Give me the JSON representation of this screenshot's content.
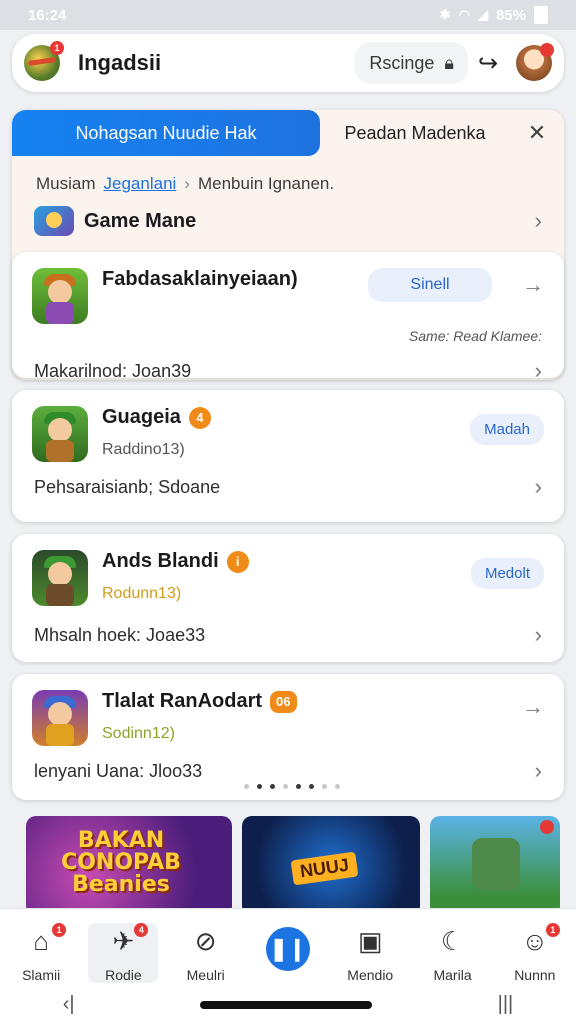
{
  "status": {
    "time": "16:24",
    "battery": "85%"
  },
  "appbar": {
    "title": "Ingadsii",
    "search_label": "Rscinge",
    "notif_count": "1"
  },
  "banner": {
    "tab_label": "Nohagsan Nuudie Hak",
    "tab2_label": "Peadan Madenka",
    "breadcrumb": [
      "Musiam",
      "Jeganlani",
      "Menbuin Ignanen."
    ],
    "game_row_label": "Game Mane"
  },
  "cards": [
    {
      "name": "Fabdasaklainyeiaan)",
      "pill": "Sinell",
      "note": "Same: Read Klamee:",
      "foot": "Makarilnod: Joan39"
    },
    {
      "name": "Guageia",
      "badge": "4",
      "sub": "Raddino13)",
      "pill": "Madah",
      "foot": "Pehsaraisianb; Sdoane"
    },
    {
      "name": "Ands Blandi",
      "badge": "i",
      "sub": "Rodunn13)",
      "pill": "Medolt",
      "foot": "Mhsaln hoek: Joae33"
    },
    {
      "name": "Tlalat RanAodart",
      "badge": "06",
      "sub": "Sodinn12)",
      "foot": "lenyani Uana: Jloo33"
    }
  ],
  "thumbs": {
    "t1": "BAKAN CONOPAB Beanies",
    "t2": "NUUJ"
  },
  "nav": [
    {
      "label": "Slamii",
      "badge": "1"
    },
    {
      "label": "Rodie",
      "badge": "4"
    },
    {
      "label": "Meulri"
    },
    {
      "label": ""
    },
    {
      "label": "Mendio"
    },
    {
      "label": "Marila"
    },
    {
      "label": "Nunnn",
      "badge": "1"
    }
  ],
  "colors": {
    "accent": "#1c74e3",
    "badge": "#f08a18",
    "alert": "#e53935"
  },
  "icons": [
    "wifi-icon",
    "signal-icon",
    "battery-icon",
    "lock-icon",
    "share-icon",
    "close-icon",
    "chevron-right-icon",
    "home-icon",
    "rocket-icon",
    "search-icon",
    "pause-icon",
    "inbox-icon",
    "moon-icon",
    "user-icon"
  ]
}
